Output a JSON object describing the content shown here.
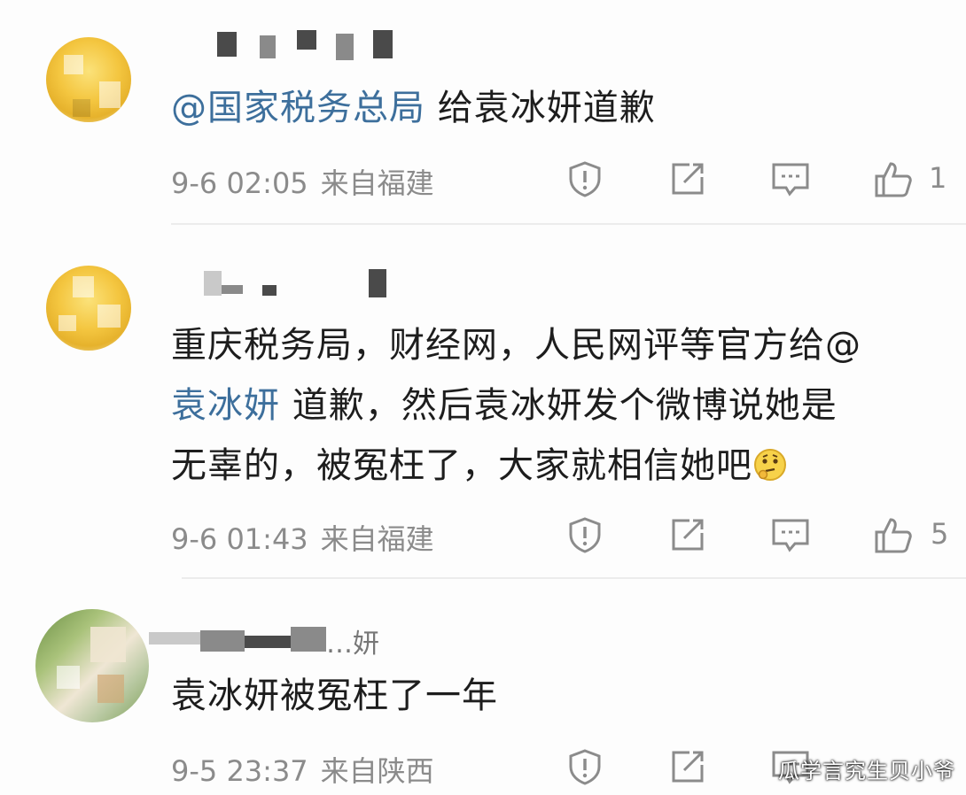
{
  "comments": [
    {
      "mention": "@国家税务总局",
      "text": " 给袁冰妍道歉",
      "date": "9-6 02:05",
      "location": "来自福建",
      "likes": "1"
    },
    {
      "line1": "重庆税务局，财经网，人民网评等官方给@",
      "mention": "袁冰妍",
      "line2_rest": " 道歉，然后袁冰妍发个微博说她是",
      "line3": "无辜的，被冤枉了，大家就相信她吧",
      "date": "9-6 01:43",
      "location": "来自福建",
      "likes": "5"
    },
    {
      "username_suffix": "…妍",
      "text": "袁冰妍被冤枉了一年",
      "date": "9-5 23:37",
      "location": "来自陕西"
    }
  ],
  "actions": {
    "report_icon": "report-icon",
    "share_icon": "share-icon",
    "comment_icon": "comment-icon",
    "like_icon": "thumbs-up-icon"
  },
  "colors": {
    "mention": "#3d6f9c",
    "meta": "#8b8b8b",
    "text": "#1d1d1d"
  },
  "watermark": "瓜学言究生贝小爷"
}
